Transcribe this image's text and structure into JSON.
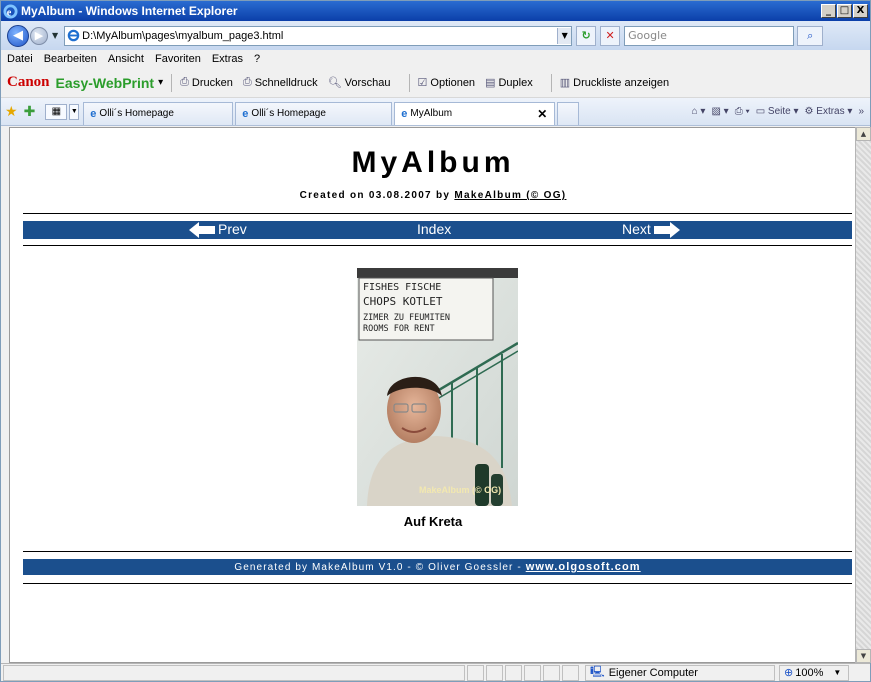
{
  "window": {
    "title": "MyAlbum - Windows Internet Explorer",
    "controls": [
      "_",
      "□",
      "X"
    ]
  },
  "address": {
    "url": "D:\\MyAlbum\\pages\\myalbum_page3.html",
    "search_placeholder": "Google"
  },
  "menu": {
    "items": [
      {
        "label": "Datei"
      },
      {
        "label": "Bearbeiten"
      },
      {
        "label": "Ansicht"
      },
      {
        "label": "Favoriten"
      },
      {
        "label": "Extras"
      },
      {
        "label": "?"
      }
    ]
  },
  "canon": {
    "logo": "Canon",
    "brand": "Easy-WebPrint",
    "dropdown": "▾",
    "buttons": [
      {
        "label": "Drucken"
      },
      {
        "label": "Schnelldruck"
      },
      {
        "label": "Vorschau"
      },
      {
        "label": "Optionen"
      },
      {
        "label": "Duplex"
      },
      {
        "label": "Druckliste anzeigen"
      }
    ]
  },
  "tabs": [
    {
      "label": "Olli´s Homepage"
    },
    {
      "label": "Olli´s Homepage"
    },
    {
      "label": "MyAlbum",
      "active": true
    }
  ],
  "tools": {
    "page_label": "Seite",
    "extras_label": "Extras",
    "more": "»"
  },
  "page": {
    "title": "MyAlbum",
    "subtitle_prefix": "Created on 03.08.2007 by ",
    "subtitle_link": "MakeAlbum (© OG)",
    "nav": {
      "prev": "Prev",
      "index": "Index",
      "next": "Next"
    },
    "photo": {
      "watermark": "MakeAlbum (© OG)",
      "sign_lines": [
        "FISHES   FISCHE",
        "CHOPS    KOTLET",
        "ZIMER ZU FEUMITEN",
        "ROOMS  FOR  RENT"
      ],
      "caption": "Auf Kreta"
    },
    "footer_prefix": "Generated by MakeAlbum V1.0 - © Oliver Goessler - ",
    "footer_link": "www.olgosoft.com"
  },
  "status": {
    "zone": "Eigener Computer",
    "zoom": "100%"
  },
  "colors": {
    "nav_band": "#1b4f8d",
    "title_bar": "#0b3fa9",
    "canon_red": "#cc0000",
    "easy_green": "#2b9d2b"
  }
}
